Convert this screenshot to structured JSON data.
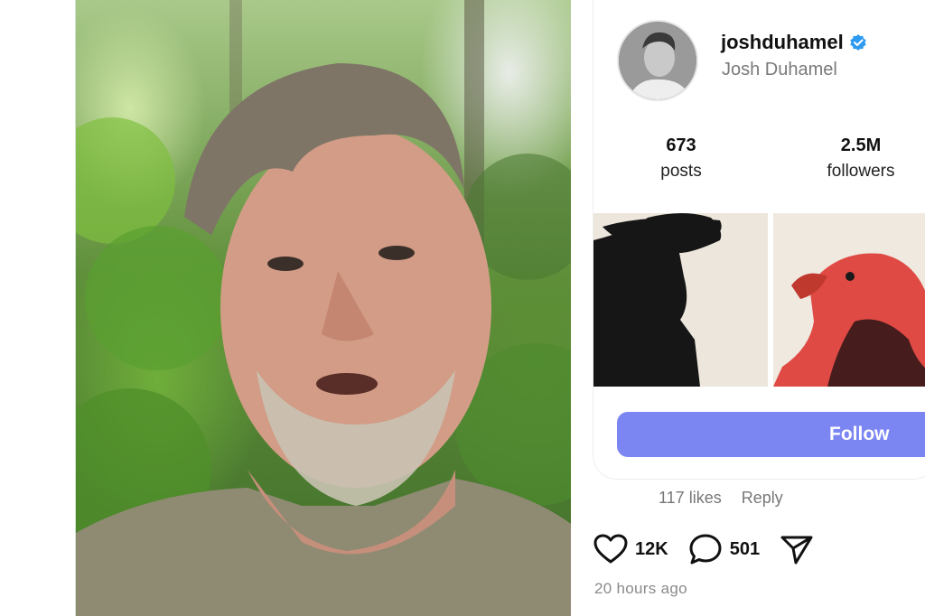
{
  "profile": {
    "username": "joshduhamel",
    "full_name": "Josh Duhamel",
    "verified": true,
    "avatar_icon": "profile-photo-avatar",
    "stats": {
      "posts_count": "673",
      "posts_label": "posts",
      "followers_count": "2.5M",
      "followers_label": "followers"
    },
    "follow_label": "Follow"
  },
  "comment": {
    "likes_text": "117 likes",
    "reply_label": "Reply"
  },
  "post_actions": {
    "like_icon": "heart-icon",
    "like_count": "12K",
    "comment_icon": "comment-bubble-icon",
    "comment_count": "501",
    "share_icon": "send-icon"
  },
  "timestamp": "20 hours ago",
  "colors": {
    "follow_button": "#7b86f3",
    "verified_badge": "#2f9bf0"
  }
}
